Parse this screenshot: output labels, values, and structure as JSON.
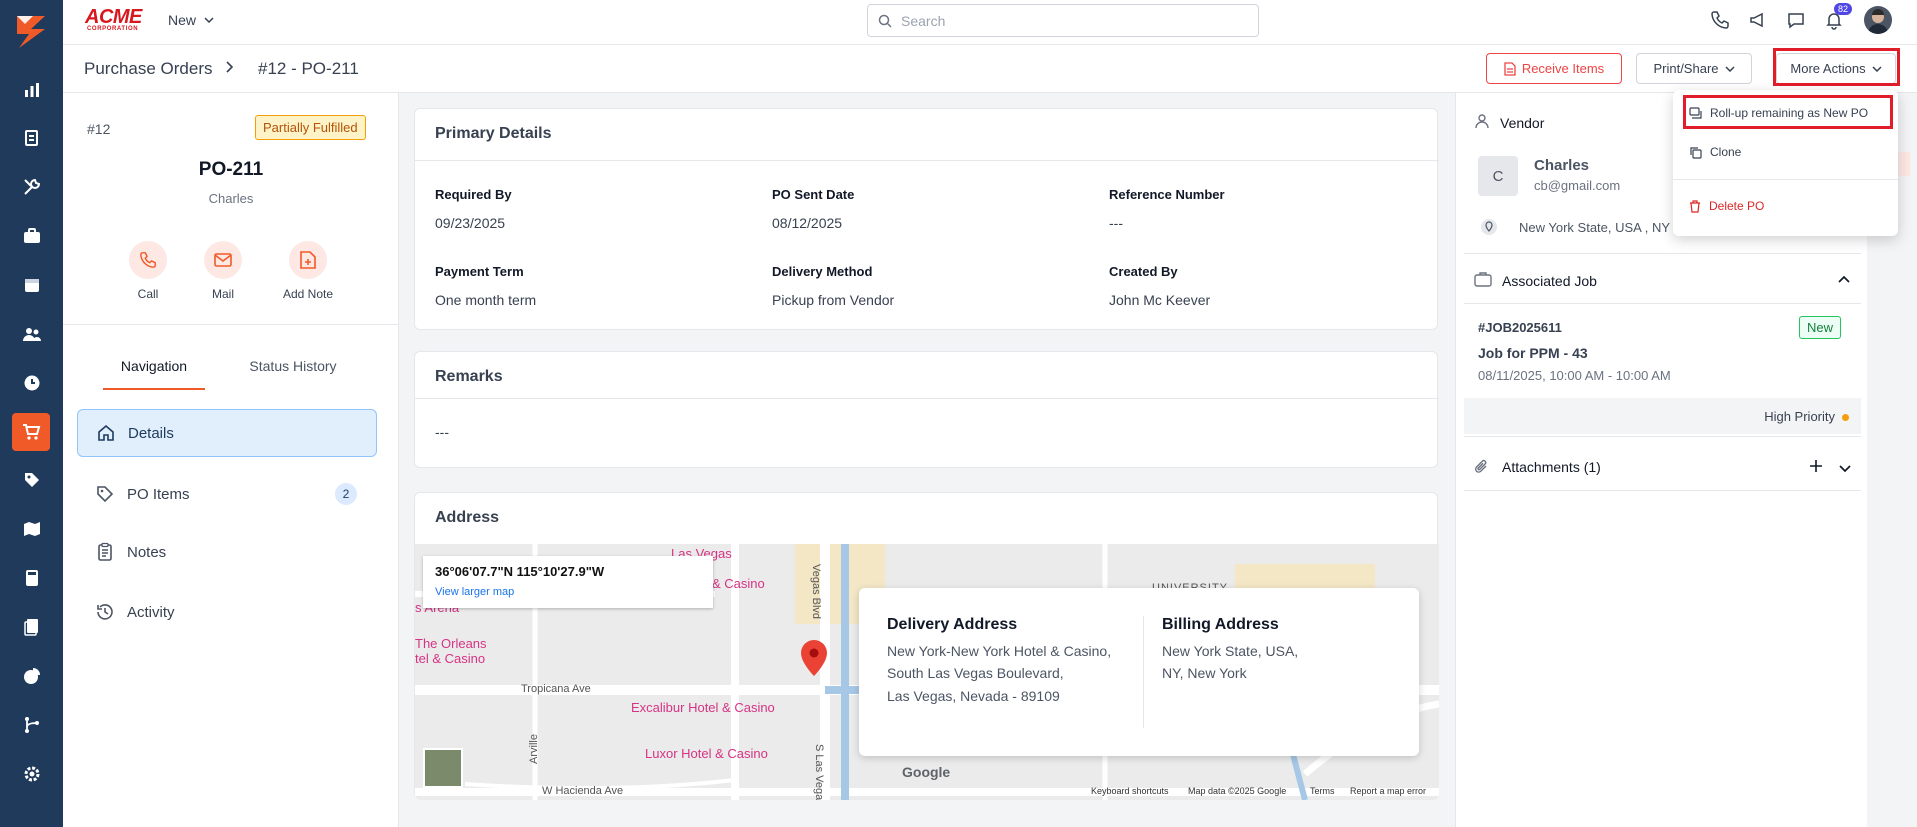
{
  "brand": {
    "word": "ACME",
    "sub": "CORPORATION"
  },
  "topbar": {
    "new_label": "New",
    "search_placeholder": "Search",
    "notification_count": "82"
  },
  "breadcrumb": {
    "parent": "Purchase Orders",
    "current": "#12 - PO-211"
  },
  "actions": {
    "receive": "Receive Items",
    "print": "Print/Share",
    "more": "More Actions"
  },
  "more_menu": {
    "items": [
      "Roll-up remaining as New PO",
      "Clone",
      "Delete PO"
    ]
  },
  "po": {
    "number": "#12",
    "status": "Partially Fulfilled",
    "title": "PO-211",
    "vendor": "Charles"
  },
  "quick_actions": [
    "Call",
    "Mail",
    "Add Note"
  ],
  "tabs": [
    "Navigation",
    "Status History"
  ],
  "nav": {
    "items": [
      {
        "label": "Details"
      },
      {
        "label": "PO Items",
        "count": "2"
      },
      {
        "label": "Notes"
      },
      {
        "label": "Activity"
      }
    ]
  },
  "primary": {
    "title": "Primary Details",
    "fields": [
      {
        "label": "Required By",
        "value": "09/23/2025"
      },
      {
        "label": "PO Sent Date",
        "value": "08/12/2025"
      },
      {
        "label": "Reference Number",
        "value": "---"
      },
      {
        "label": "Payment Term",
        "value": "One month term"
      },
      {
        "label": "Delivery Method",
        "value": "Pickup from Vendor"
      },
      {
        "label": "Created By",
        "value": "John Mc Keever"
      }
    ]
  },
  "remarks": {
    "title": "Remarks",
    "value": "---"
  },
  "address": {
    "title": "Address",
    "map_coord": "36°06'07.7\"N 115°10'27.9\"W",
    "map_link": "View larger map",
    "delivery_title": "Delivery Address",
    "delivery_lines": [
      "New York-New York Hotel & Casino,",
      "South Las Vegas Boulevard,",
      "Las Vegas, Nevada - 89109"
    ],
    "billing_title": "Billing Address",
    "billing_lines": [
      "New York State, USA,",
      "NY, New York"
    ],
    "map_labels": [
      "Las Vegas",
      "& Casino",
      "s Arena",
      "The Orleans",
      "tel & Casino",
      "Excalibur Hotel & Casino",
      "Luxor Hotel & Casino"
    ],
    "map_streets": [
      "Tropicana Ave",
      "W Hacienda Ave",
      "Vegas Blvd",
      "S Las Vegas",
      "Arville",
      "UNIVERSITY"
    ],
    "map_footer": [
      "Keyboard shortcuts",
      "Map data ©2025 Google",
      "Terms",
      "Report a map error"
    ],
    "google": "Google"
  },
  "vendor": {
    "section": "Vendor",
    "initial": "C",
    "name": "Charles",
    "email": "cb@gmail.com",
    "location": "New York State, USA , NY"
  },
  "job": {
    "section": "Associated Job",
    "id": "#JOB2025611",
    "badge": "New",
    "title": "Job for PPM - 43",
    "time": "08/11/2025, 10:00 AM - 10:00 AM",
    "priority": "High Priority"
  },
  "attachments": {
    "label": "Attachments (1)"
  },
  "colors": {
    "accent": "#f05a28",
    "rail": "#1f3a5a",
    "highlight": "#e11d2a"
  }
}
